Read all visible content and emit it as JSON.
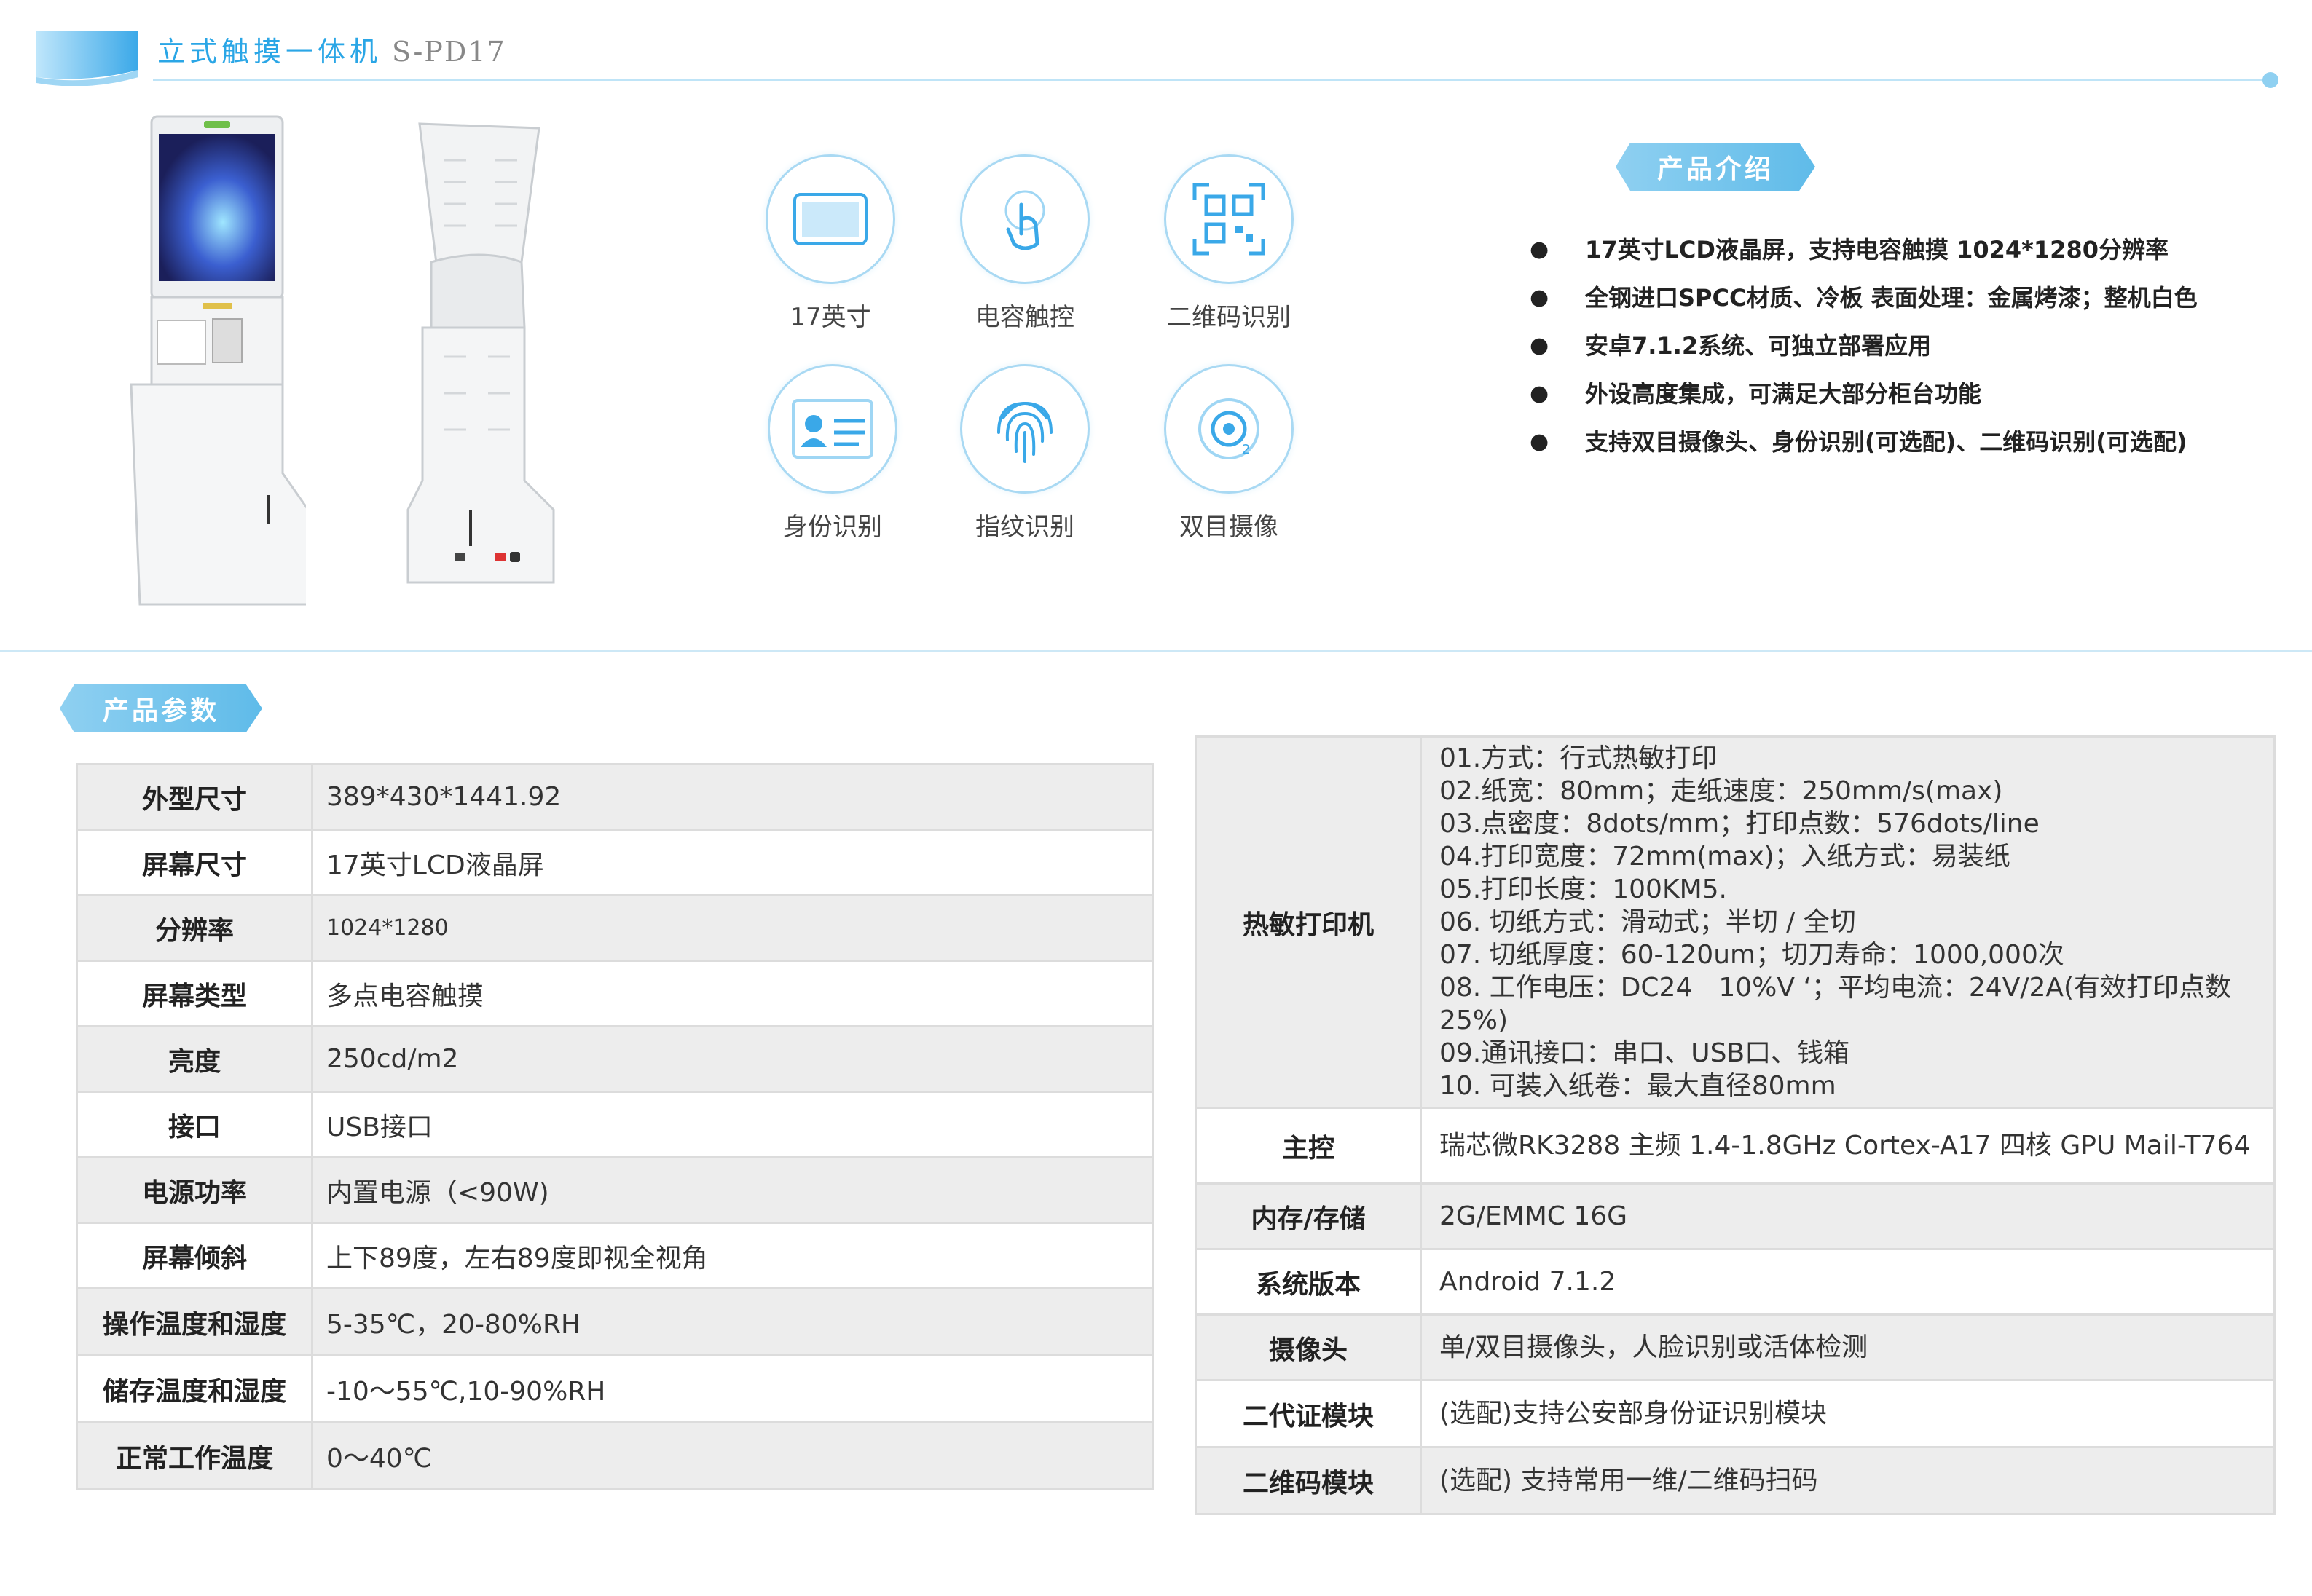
{
  "header": {
    "title": "立式触摸一体机",
    "model": "S-PD17"
  },
  "features": [
    {
      "icon": "screen-icon",
      "label": "17英寸"
    },
    {
      "icon": "touch-icon",
      "label": "电容触控"
    },
    {
      "icon": "qrcode-icon",
      "label": "二维码识别"
    },
    {
      "icon": "id-card-icon",
      "label": "身份识别"
    },
    {
      "icon": "fingerprint-icon",
      "label": "指纹识别"
    },
    {
      "icon": "camera-icon",
      "label": "双目摄像"
    }
  ],
  "intro": {
    "title": "产品介绍",
    "items": [
      "17英寸LCD液晶屏，支持电容触摸 1024*1280分辨率",
      "全钢进口SPCC材质、冷板 表面处理：金属烤漆；整机白色",
      "安卓7.1.2系统、可独立部署应用",
      "外设高度集成，可满足大部分柜台功能",
      "支持双目摄像头、身份识别(可选配)、二维码识别(可选配)"
    ]
  },
  "params": {
    "title": "产品参数",
    "left": [
      {
        "k": "外型尺寸",
        "v": "389*430*1441.92"
      },
      {
        "k": "屏幕尺寸",
        "v": "17英寸LCD液晶屏"
      },
      {
        "k": "分辨率",
        "v": "1024*1280"
      },
      {
        "k": "屏幕类型",
        "v": "多点电容触摸"
      },
      {
        "k": "亮度",
        "v": "250cd/m2"
      },
      {
        "k": "接口",
        "v": "USB接口"
      },
      {
        "k": "电源功率",
        "v": "内置电源（<90W)"
      },
      {
        "k": "屏幕倾斜",
        "v": "上下89度，左右89度即视全视角"
      },
      {
        "k": "操作温度和湿度",
        "v": "5-35℃，20-80%RH"
      },
      {
        "k": "储存温度和湿度",
        "v": "-10～55℃,10-90%RH"
      },
      {
        "k": "正常工作温度",
        "v": "0～40℃"
      }
    ],
    "printer": {
      "k": "热敏打印机",
      "lines": [
        "01.方式：行式热敏打印",
        "02.纸宽：80mm；走纸速度：250mm/s(max)",
        "03.点密度：8dots/mm；打印点数：576dots/line",
        "04.打印宽度：72mm(max)；入纸方式：易装纸",
        "05.打印长度：100KM5.",
        "06. 切纸方式：滑动式；半切 / 全切",
        "07. 切纸厚度：60-120um；切刀寿命：1000,000次",
        "08. 工作电压：DC24　10%V ‘；平均电流：24V/2A(有效打印点数25%)",
        "09.通讯接口：串口、USB口、钱箱",
        "10. 可装入纸卷：最大直径80mm"
      ]
    },
    "right": [
      {
        "k": "主控",
        "v": "瑞芯微RK3288 主频 1.4-1.8GHz Cortex-A17 四核 GPU Mail-T764"
      },
      {
        "k": "内存/存储",
        "v": "2G/EMMC 16G"
      },
      {
        "k": "系统版本",
        "v": "Android 7.1.2"
      },
      {
        "k": "摄像头",
        "v": "单/双目摄像头，人脸识别或活体检测"
      },
      {
        "k": "二代证模块",
        "v": "(选配)支持公安部身份证识别模块"
      },
      {
        "k": "二维码模块",
        "v": "(选配) 支持常用一维/二维码扫码"
      }
    ]
  }
}
